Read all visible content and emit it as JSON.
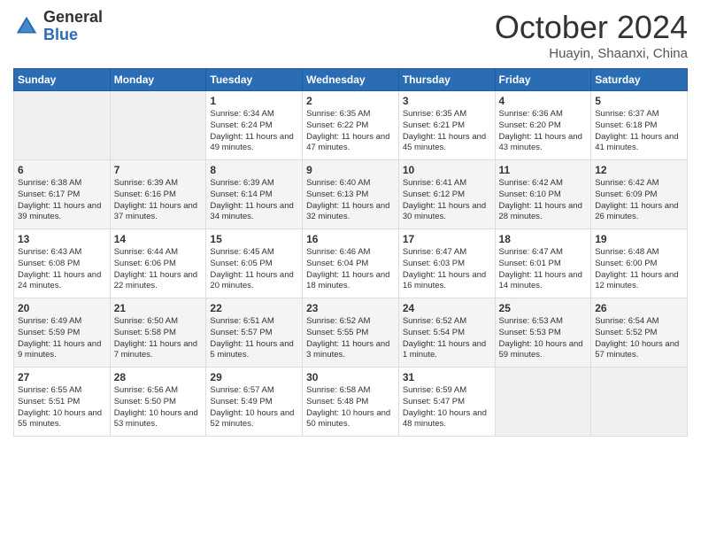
{
  "header": {
    "logo_general": "General",
    "logo_blue": "Blue",
    "month": "October 2024",
    "location": "Huayin, Shaanxi, China"
  },
  "days_of_week": [
    "Sunday",
    "Monday",
    "Tuesday",
    "Wednesday",
    "Thursday",
    "Friday",
    "Saturday"
  ],
  "weeks": [
    [
      {
        "day": null,
        "sunrise": null,
        "sunset": null,
        "daylight": null
      },
      {
        "day": null,
        "sunrise": null,
        "sunset": null,
        "daylight": null
      },
      {
        "day": "1",
        "sunrise": "Sunrise: 6:34 AM",
        "sunset": "Sunset: 6:24 PM",
        "daylight": "Daylight: 11 hours and 49 minutes."
      },
      {
        "day": "2",
        "sunrise": "Sunrise: 6:35 AM",
        "sunset": "Sunset: 6:22 PM",
        "daylight": "Daylight: 11 hours and 47 minutes."
      },
      {
        "day": "3",
        "sunrise": "Sunrise: 6:35 AM",
        "sunset": "Sunset: 6:21 PM",
        "daylight": "Daylight: 11 hours and 45 minutes."
      },
      {
        "day": "4",
        "sunrise": "Sunrise: 6:36 AM",
        "sunset": "Sunset: 6:20 PM",
        "daylight": "Daylight: 11 hours and 43 minutes."
      },
      {
        "day": "5",
        "sunrise": "Sunrise: 6:37 AM",
        "sunset": "Sunset: 6:18 PM",
        "daylight": "Daylight: 11 hours and 41 minutes."
      }
    ],
    [
      {
        "day": "6",
        "sunrise": "Sunrise: 6:38 AM",
        "sunset": "Sunset: 6:17 PM",
        "daylight": "Daylight: 11 hours and 39 minutes."
      },
      {
        "day": "7",
        "sunrise": "Sunrise: 6:39 AM",
        "sunset": "Sunset: 6:16 PM",
        "daylight": "Daylight: 11 hours and 37 minutes."
      },
      {
        "day": "8",
        "sunrise": "Sunrise: 6:39 AM",
        "sunset": "Sunset: 6:14 PM",
        "daylight": "Daylight: 11 hours and 34 minutes."
      },
      {
        "day": "9",
        "sunrise": "Sunrise: 6:40 AM",
        "sunset": "Sunset: 6:13 PM",
        "daylight": "Daylight: 11 hours and 32 minutes."
      },
      {
        "day": "10",
        "sunrise": "Sunrise: 6:41 AM",
        "sunset": "Sunset: 6:12 PM",
        "daylight": "Daylight: 11 hours and 30 minutes."
      },
      {
        "day": "11",
        "sunrise": "Sunrise: 6:42 AM",
        "sunset": "Sunset: 6:10 PM",
        "daylight": "Daylight: 11 hours and 28 minutes."
      },
      {
        "day": "12",
        "sunrise": "Sunrise: 6:42 AM",
        "sunset": "Sunset: 6:09 PM",
        "daylight": "Daylight: 11 hours and 26 minutes."
      }
    ],
    [
      {
        "day": "13",
        "sunrise": "Sunrise: 6:43 AM",
        "sunset": "Sunset: 6:08 PM",
        "daylight": "Daylight: 11 hours and 24 minutes."
      },
      {
        "day": "14",
        "sunrise": "Sunrise: 6:44 AM",
        "sunset": "Sunset: 6:06 PM",
        "daylight": "Daylight: 11 hours and 22 minutes."
      },
      {
        "day": "15",
        "sunrise": "Sunrise: 6:45 AM",
        "sunset": "Sunset: 6:05 PM",
        "daylight": "Daylight: 11 hours and 20 minutes."
      },
      {
        "day": "16",
        "sunrise": "Sunrise: 6:46 AM",
        "sunset": "Sunset: 6:04 PM",
        "daylight": "Daylight: 11 hours and 18 minutes."
      },
      {
        "day": "17",
        "sunrise": "Sunrise: 6:47 AM",
        "sunset": "Sunset: 6:03 PM",
        "daylight": "Daylight: 11 hours and 16 minutes."
      },
      {
        "day": "18",
        "sunrise": "Sunrise: 6:47 AM",
        "sunset": "Sunset: 6:01 PM",
        "daylight": "Daylight: 11 hours and 14 minutes."
      },
      {
        "day": "19",
        "sunrise": "Sunrise: 6:48 AM",
        "sunset": "Sunset: 6:00 PM",
        "daylight": "Daylight: 11 hours and 12 minutes."
      }
    ],
    [
      {
        "day": "20",
        "sunrise": "Sunrise: 6:49 AM",
        "sunset": "Sunset: 5:59 PM",
        "daylight": "Daylight: 11 hours and 9 minutes."
      },
      {
        "day": "21",
        "sunrise": "Sunrise: 6:50 AM",
        "sunset": "Sunset: 5:58 PM",
        "daylight": "Daylight: 11 hours and 7 minutes."
      },
      {
        "day": "22",
        "sunrise": "Sunrise: 6:51 AM",
        "sunset": "Sunset: 5:57 PM",
        "daylight": "Daylight: 11 hours and 5 minutes."
      },
      {
        "day": "23",
        "sunrise": "Sunrise: 6:52 AM",
        "sunset": "Sunset: 5:55 PM",
        "daylight": "Daylight: 11 hours and 3 minutes."
      },
      {
        "day": "24",
        "sunrise": "Sunrise: 6:52 AM",
        "sunset": "Sunset: 5:54 PM",
        "daylight": "Daylight: 11 hours and 1 minute."
      },
      {
        "day": "25",
        "sunrise": "Sunrise: 6:53 AM",
        "sunset": "Sunset: 5:53 PM",
        "daylight": "Daylight: 10 hours and 59 minutes."
      },
      {
        "day": "26",
        "sunrise": "Sunrise: 6:54 AM",
        "sunset": "Sunset: 5:52 PM",
        "daylight": "Daylight: 10 hours and 57 minutes."
      }
    ],
    [
      {
        "day": "27",
        "sunrise": "Sunrise: 6:55 AM",
        "sunset": "Sunset: 5:51 PM",
        "daylight": "Daylight: 10 hours and 55 minutes."
      },
      {
        "day": "28",
        "sunrise": "Sunrise: 6:56 AM",
        "sunset": "Sunset: 5:50 PM",
        "daylight": "Daylight: 10 hours and 53 minutes."
      },
      {
        "day": "29",
        "sunrise": "Sunrise: 6:57 AM",
        "sunset": "Sunset: 5:49 PM",
        "daylight": "Daylight: 10 hours and 52 minutes."
      },
      {
        "day": "30",
        "sunrise": "Sunrise: 6:58 AM",
        "sunset": "Sunset: 5:48 PM",
        "daylight": "Daylight: 10 hours and 50 minutes."
      },
      {
        "day": "31",
        "sunrise": "Sunrise: 6:59 AM",
        "sunset": "Sunset: 5:47 PM",
        "daylight": "Daylight: 10 hours and 48 minutes."
      },
      {
        "day": null,
        "sunrise": null,
        "sunset": null,
        "daylight": null
      },
      {
        "day": null,
        "sunrise": null,
        "sunset": null,
        "daylight": null
      }
    ]
  ]
}
